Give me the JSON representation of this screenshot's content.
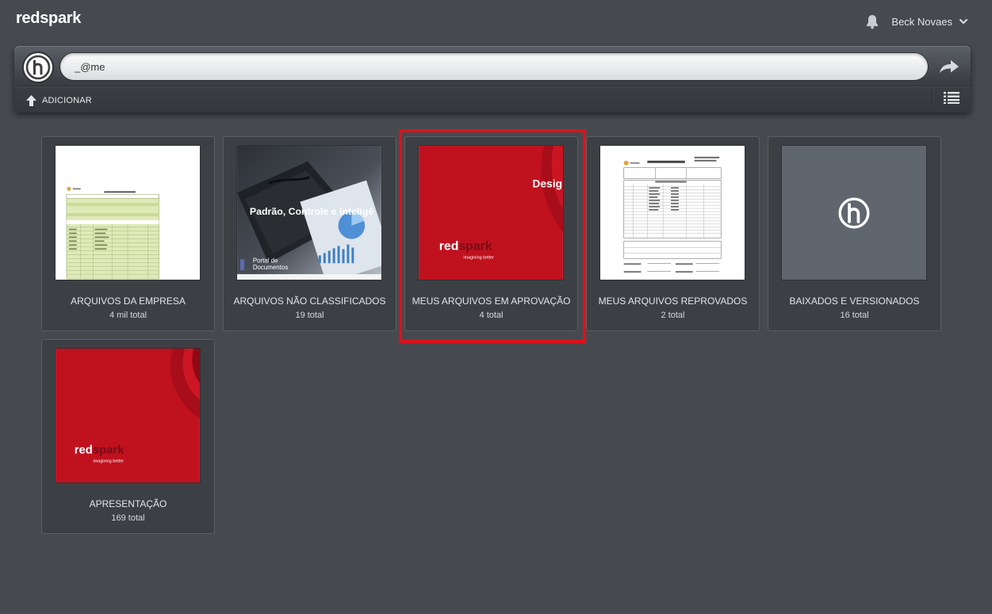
{
  "header": {
    "brand": "redspark",
    "user_name": "Beck Novaes"
  },
  "command_bar": {
    "search_value": "_@me",
    "add_label": "ADICIONAR"
  },
  "folders": [
    {
      "title": "ARQUIVOS DA EMPRESA",
      "count": "4 mil total"
    },
    {
      "title": "ARQUIVOS NÃO CLASSIFICADOS",
      "count": "19 total"
    },
    {
      "title": "MEUS ARQUIVOS EM APROVAÇÃO",
      "count": "4 total",
      "highlighted": true
    },
    {
      "title": "MEUS ARQUIVOS REPROVADOS",
      "count": "2 total"
    },
    {
      "title": "BAIXADOS E VERSIONADOS",
      "count": "16 total"
    },
    {
      "title": "APRESENTAÇÃO",
      "count": "169 total"
    }
  ],
  "thumbnails": {
    "arquivos_nao_classificados": {
      "headline": "Padrão, Controle e Inteligê",
      "caption_line1": "Portal de",
      "caption_line2": "Documentos"
    },
    "meus_arquivos_em_aprovacao": {
      "corner_text": "Desig",
      "logo_red": "red",
      "logo_spark": "spark",
      "tagline": "imagining better"
    },
    "apresentacao": {
      "logo_red": "red",
      "logo_spark": "spark",
      "tagline": "imagining better"
    }
  },
  "colors": {
    "background": "#464a4f",
    "card_background": "#3c4045",
    "highlight": "#e0101a",
    "brand_red": "#c0111f"
  },
  "icons": {
    "notification": "bell-icon",
    "user_menu": "chevron-down-icon",
    "app_logo": "h-logo-icon",
    "share": "share-arrow-icon",
    "add": "upload-arrow-icon",
    "list_view": "list-view-icon"
  }
}
